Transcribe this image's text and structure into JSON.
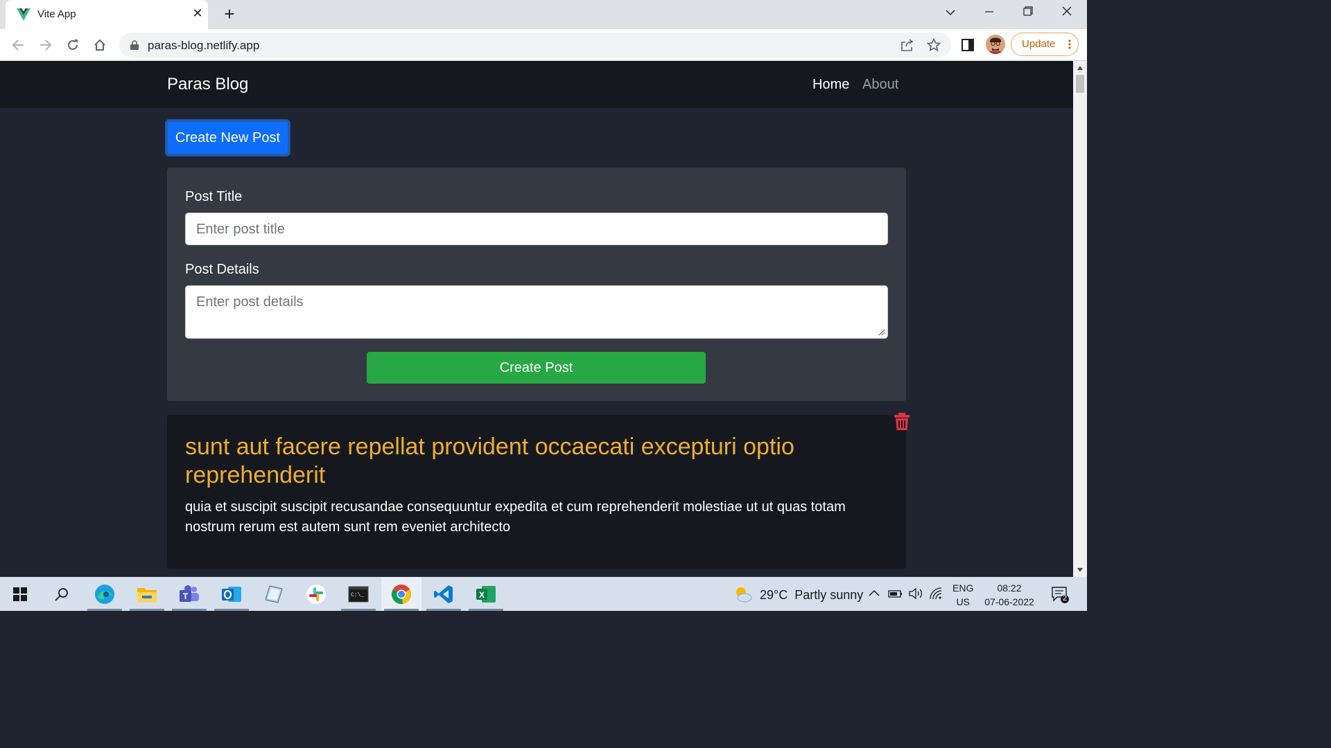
{
  "browser": {
    "tab_title": "Vite App",
    "url": "paras-blog.netlify.app",
    "update_label": "Update"
  },
  "site": {
    "brand": "Paras Blog",
    "nav": [
      {
        "label": "Home",
        "active": true
      },
      {
        "label": "About",
        "active": false
      }
    ]
  },
  "actions": {
    "create_new_post": "Create New Post",
    "create_post": "Create Post"
  },
  "form": {
    "title_label": "Post Title",
    "title_placeholder": "Enter post title",
    "title_value": "",
    "details_label": "Post Details",
    "details_placeholder": "Enter post details",
    "details_value": ""
  },
  "posts": [
    {
      "title": "sunt aut facere repellat provident occaecati excepturi optio reprehenderit",
      "body": "quia et suscipit suscipit recusandae consequuntur expedita et cum reprehenderit molestiae ut ut quas totam nostrum rerum est autem sunt rem eveniet architecto"
    }
  ],
  "taskbar": {
    "weather": "29°C  Partly sunny",
    "lang_top": "ENG",
    "lang_bottom": "US",
    "time": "08:22",
    "date": "07-06-2022",
    "notification_count": "2"
  },
  "colors": {
    "primary": "#0d6efd",
    "success": "#28a745",
    "post_title": "#f0ad2e",
    "danger": "#dc3545",
    "page_bg": "#1f2430",
    "navbar_bg": "#15191f"
  }
}
